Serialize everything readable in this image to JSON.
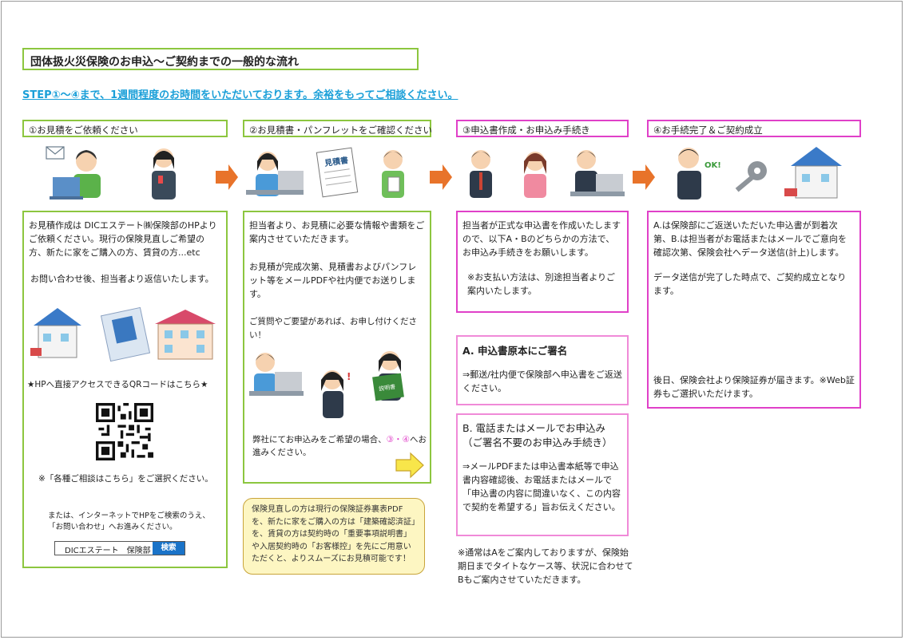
{
  "title": "団体扱火災保険のお申込～ご契約までの一般的な流れ",
  "step_note": "STEP①～④まで、1週間程度のお時間をいただいております。余裕をもってご相談ください。",
  "steps": [
    {
      "header": "①お見積をご依頼ください"
    },
    {
      "header": "②お見積書・パンフレットをご確認ください"
    },
    {
      "header": "③申込書作成・お申込み手続き"
    },
    {
      "header": "④お手続完了＆ご契約成立"
    }
  ],
  "col1": {
    "p1": "お見積作成は DICエステート㈱保険部のHPよりご依頼ください。現行の保険見直しご希望の方、新たに家をご購入の方、賃貸の方...etc",
    "p2": "お問い合わせ後、担当者より返信いたします。",
    "qr_caption": "★HPへ直接アクセスできるQRコードはこちら★",
    "select_note": "※「各種ご相談はこちら」をご選択ください。",
    "internet_note": "または、インターネットでHPをご検索のうえ、「お問い合わせ」へお進みください。",
    "search_value": "DICエステート　保険部",
    "search_button": "検索"
  },
  "col2": {
    "p1": "担当者より、お見積に必要な情報や書類をご案内させていただきます。",
    "p2": "お見積が完成次第、見積書およびパンフレット等をメールPDFや社内便でお送りします。",
    "p3": "ご質問やご要望があれば、お申し付けください！",
    "p4_a": "弊社にてお申込みをご希望の場合、",
    "p4_b": "③・④",
    "p4_c": "へお進みください。",
    "estimate_label": "見積書",
    "manual_label": "説明書"
  },
  "note_bubble": "保険見直しの方は現行の保険証券裏表PDFを、新たに家をご購入の方は「建築確認済証」を、賃貸の方は契約時の「重要事項説明書」や入居契約時の「お客様控」を先にご用意いただくと、よりスムーズにお見積可能です！",
  "col3": {
    "p1": "担当者が正式な申込書を作成いたしますので、以下A・Bのどちらかの方法で、お申込み手続きをお願いします。",
    "p2": "※お支払い方法は、別途担当者よりご案内いたします。",
    "a_title": "A.  申込書原本にご署名",
    "a_body": "⇒郵送/社内便で保険部へ申込書をご返送ください。",
    "b_title": "B. 電話またはメールでお申込み（ご署名不要のお申込み手続き）",
    "b_body": "⇒メールPDFまたは申込書本紙等で申込書内容確認後、お電話またはメールで「申込書の内容に間違いなく、この内容で契約を希望する」旨お伝えください。",
    "footnote": "※通常はAをご案内しておりますが、保険始期日までタイトなケース等、状況に合わせてBもご案内させていただきます。"
  },
  "col4": {
    "p1": "A.は保険部にご返送いただいた申込書が到着次第、B.は担当者がお電話またはメールでご意向を確認次第、保険会社へデータ送信(計上)します。",
    "p2": "データ送信が完了した時点で、ご契約成立となります。",
    "p3": "後日、保険会社より保険証券が届きます。※Web証券もご選択いただけます。",
    "ok_label": "OK!"
  },
  "colors": {
    "green": "#8cc63f",
    "magenta": "#e040c8",
    "pink": "#f08ad8",
    "blue": "#1a9fd8",
    "arrow": "#e8732a"
  },
  "icons": [
    "person-laptop-icon",
    "person-phone-icon",
    "arrow-right-icon",
    "document-icon",
    "house-icon",
    "qr-code-icon",
    "key-icon",
    "envelope-icon"
  ]
}
